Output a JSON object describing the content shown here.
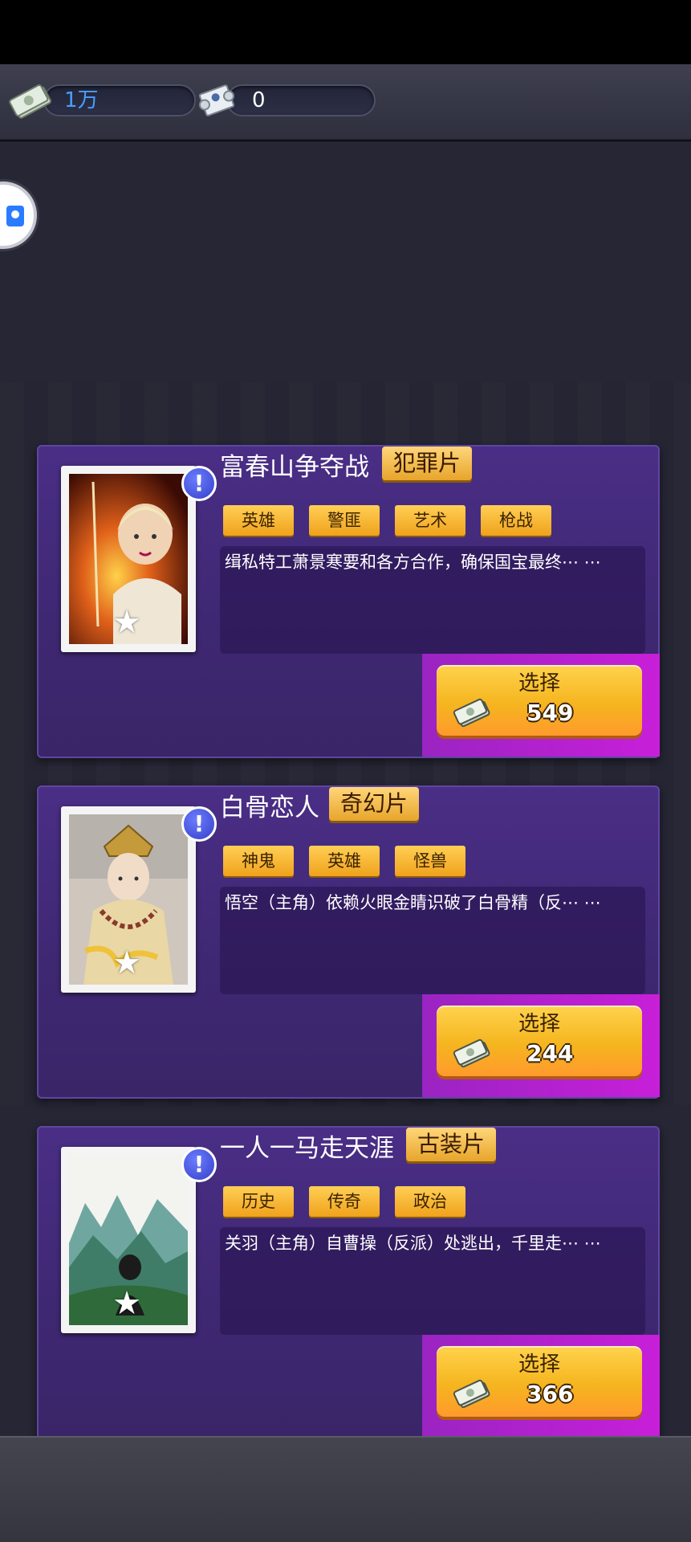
{
  "resources": {
    "money": {
      "value": "1万",
      "color": "#4a9eff",
      "icon": "cash-icon"
    },
    "scripts": {
      "value": "0",
      "color": "#ffffff",
      "icon": "scroll-icon"
    }
  },
  "movies": [
    {
      "title": "富春山争夺战",
      "genre": "犯罪片",
      "tags": [
        "英雄",
        "警匪",
        "艺术",
        "枪战"
      ],
      "description": "缉私特工萧景寒要和各方合作，确保国宝最终⋯ ⋯",
      "select_label": "选择",
      "price": "549"
    },
    {
      "title": "白骨恋人",
      "genre": "奇幻片",
      "tags": [
        "神鬼",
        "英雄",
        "怪兽"
      ],
      "description": "悟空（主角）依赖火眼金睛识破了白骨精（反⋯ ⋯",
      "select_label": "选择",
      "price": "244"
    },
    {
      "title": "一人一马走天涯",
      "genre": "古装片",
      "tags": [
        "历史",
        "传奇",
        "政治"
      ],
      "description": "关羽（主角）自曹操（反派）处逃出，千里走⋯ ⋯",
      "select_label": "选择",
      "price": "366"
    }
  ],
  "colors": {
    "card": "#452b7c",
    "select_frame": "#b91fd0",
    "tag": "#f5b52a"
  }
}
